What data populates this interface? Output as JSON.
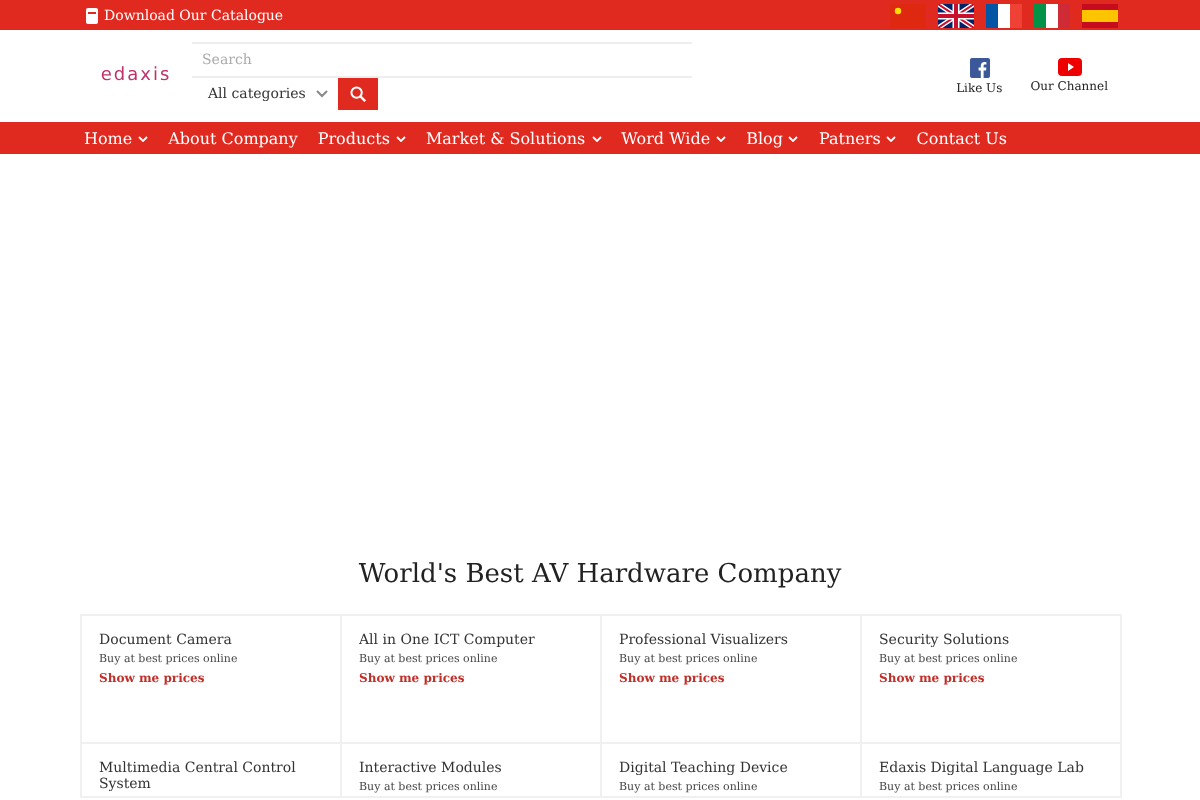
{
  "top_bar": {
    "catalogue_link": "Download Our Catalogue",
    "flags": [
      {
        "kind": "china"
      },
      {
        "kind": "uk"
      },
      {
        "kind": "france"
      },
      {
        "kind": "italy"
      },
      {
        "kind": "spain"
      }
    ]
  },
  "header": {
    "logo": "edaxis",
    "search": {
      "placeholder": "Search"
    },
    "category_select": "All categories",
    "social": [
      {
        "kind": "facebook",
        "label": "Like Us"
      },
      {
        "kind": "youtube",
        "label": "Our Channel"
      }
    ]
  },
  "nav": [
    {
      "label": "Home",
      "has_menu": true
    },
    {
      "label": "About Company",
      "has_menu": false
    },
    {
      "label": "Products",
      "has_menu": true
    },
    {
      "label": "Market & Solutions",
      "has_menu": true
    },
    {
      "label": "Word Wide",
      "has_menu": true
    },
    {
      "label": "Blog",
      "has_menu": true
    },
    {
      "label": "Patners",
      "has_menu": true
    },
    {
      "label": "Contact Us",
      "has_menu": false
    }
  ],
  "section_title": "World's Best AV Hardware Company",
  "cards": [
    {
      "title": "Document Camera",
      "subtitle": "Buy at best prices online",
      "link": "Show me prices"
    },
    {
      "title": "All in One ICT Computer",
      "subtitle": "Buy at best prices online",
      "link": "Show me prices"
    },
    {
      "title": "Professional Visualizers",
      "subtitle": "Buy at best prices online",
      "link": "Show me prices"
    },
    {
      "title": "Security Solutions",
      "subtitle": "Buy at best prices online",
      "link": "Show me prices"
    },
    {
      "title": "Multimedia Central Control System"
    },
    {
      "title": "Interactive Modules",
      "subtitle": "Buy at best prices online"
    },
    {
      "title": "Digital Teaching Device",
      "subtitle": "Buy at best prices online"
    },
    {
      "title": "Edaxis Digital Language Lab",
      "subtitle": "Buy at best prices online"
    }
  ]
}
